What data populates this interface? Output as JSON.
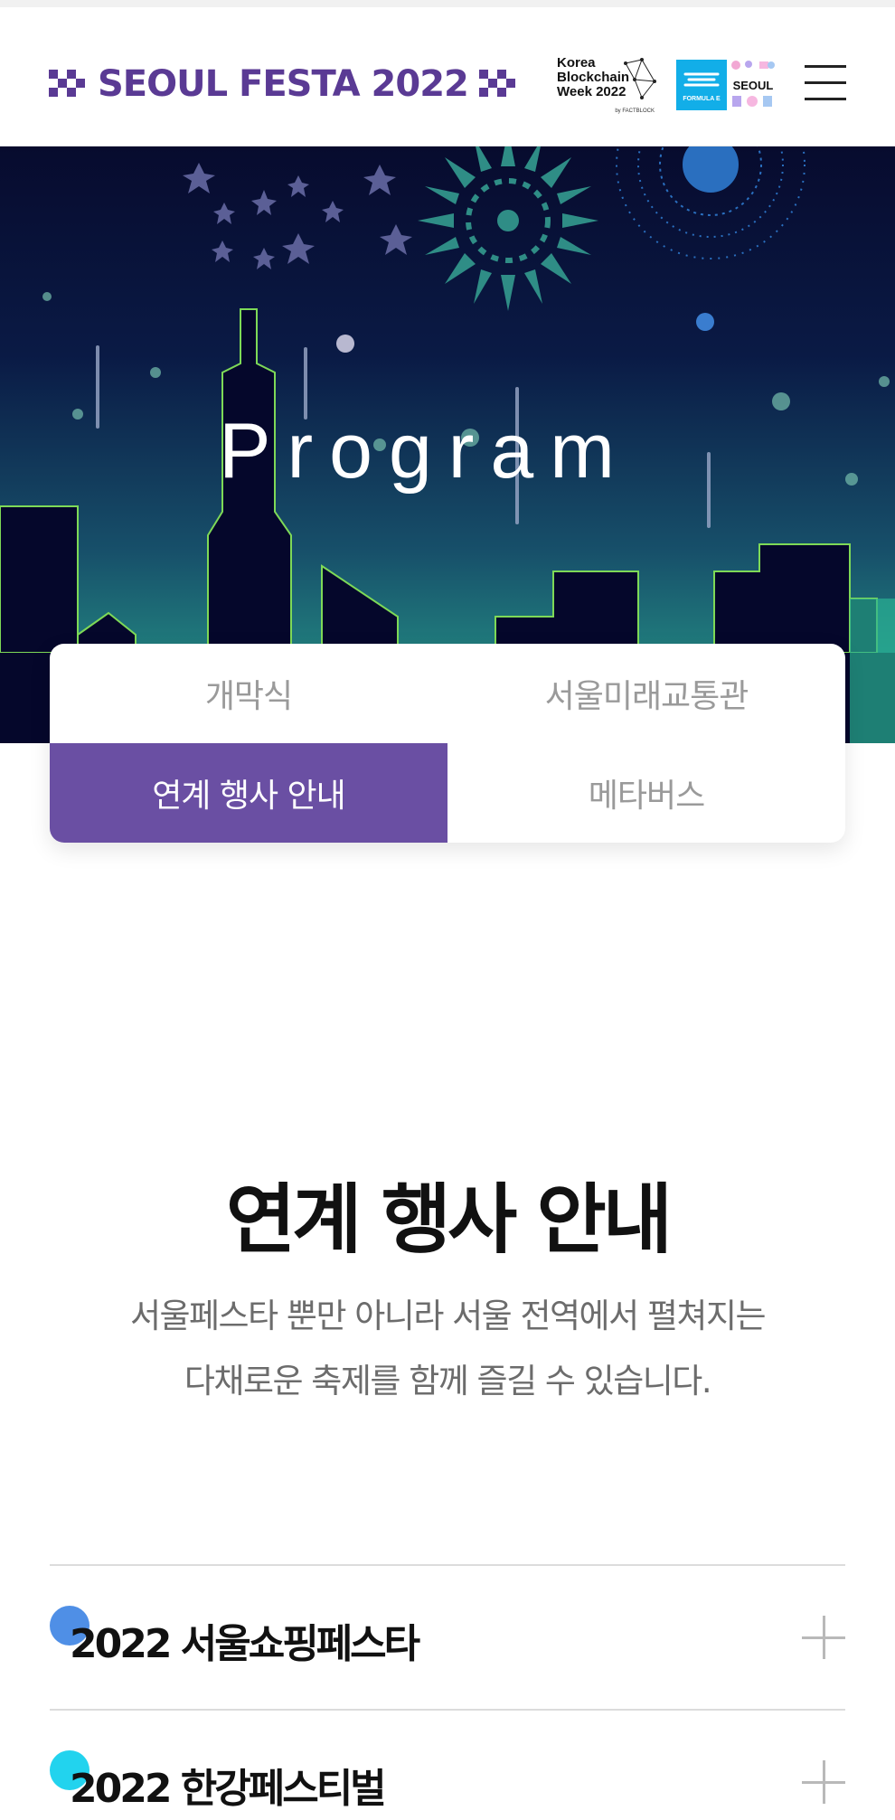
{
  "header": {
    "logo_text": "SEOUL FESTA 2022",
    "partner_kbw": {
      "line1": "Korea",
      "line2": "Blockchain",
      "line3": "Week 2022",
      "sub": "by FACTBLOCK"
    },
    "partner_fe": {
      "label": "FORMULA E"
    },
    "partner_seoul": {
      "label": "SEOUL"
    },
    "brand_color": "#5a3a94"
  },
  "hero": {
    "title": "Program"
  },
  "tabs": [
    {
      "label": "개막식",
      "active": false
    },
    {
      "label": "서울미래교통관",
      "active": false
    },
    {
      "label": "연계 행사 안내",
      "active": true
    },
    {
      "label": "메타버스",
      "active": false
    }
  ],
  "section": {
    "title": "연계 행사 안내",
    "desc_line1": "서울페스타 뿐만 아니라 서울 전역에서 펼쳐지는",
    "desc_line2": "다채로운 축제를 함께 즐길 수 있습니다."
  },
  "accordion": [
    {
      "title": "2022 서울쇼핑페스타",
      "dot_color": "#4f8fe6",
      "icon": "plus-icon"
    },
    {
      "title": "2022 한강페스티벌",
      "dot_color": "#22d3ee",
      "icon": "plus-icon"
    }
  ],
  "colors": {
    "active_tab": "#6a4fa3",
    "hero_top": "#070b2e",
    "hero_bottom": "#2aa78f"
  }
}
